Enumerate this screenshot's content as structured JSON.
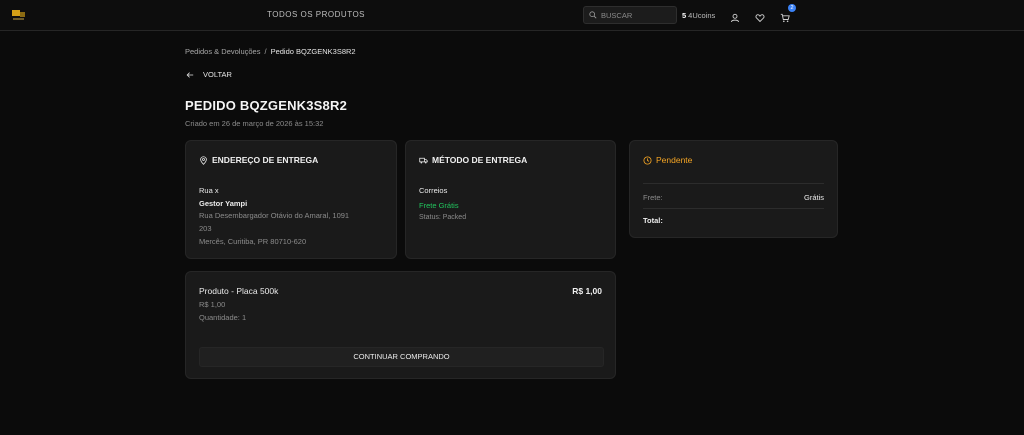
{
  "header": {
    "nav_all_products": "TODOS OS PRODUTOS",
    "search_placeholder": "BUSCAR",
    "coins_value": "5",
    "coins_unit": "4Ucoins",
    "cart_count": "2"
  },
  "breadcrumb": {
    "parent": "Pedidos & Devoluções",
    "separator": "/",
    "current": "Pedido BQZGENK3S8R2"
  },
  "back_label": "VOLTAR",
  "order": {
    "title": "PEDIDO BQZGENK3S8R2",
    "created": "Criado em 26 de março de 2026 às 15:32"
  },
  "address": {
    "heading": "ENDEREÇO DE ENTREGA",
    "line1": "Rua x",
    "name": "Gestor Yampi",
    "street": "Rua Desembargador Otávio do Amaral, 1091",
    "complement": "203",
    "city": "Mercês, Curitiba, PR 80710-620"
  },
  "shipping": {
    "heading": "MÉTODO DE ENTREGA",
    "carrier": "Correios",
    "free_label": "Frete Grátis",
    "status": "Status: Packed"
  },
  "summary": {
    "status": "Pendente",
    "freight_label": "Frete:",
    "freight_value": "Grátis",
    "total_label": "Total:"
  },
  "product": {
    "name": "Produto - Placa 500k",
    "price_right": "R$ 1,00",
    "price": "R$ 1,00",
    "quantity": "Quantidade: 1",
    "continue_label": "CONTINUAR COMPRANDO"
  },
  "colors": {
    "accent_orange": "#f5a524",
    "free_green": "#22c55e",
    "badge_blue": "#3b82f6"
  },
  "icons": {
    "logo": "brand-logo",
    "search": "search-icon",
    "user": "user-icon",
    "heart": "heart-icon",
    "cart": "cart-icon",
    "back": "arrow-left-icon",
    "address": "map-pin-icon",
    "shipping": "truck-icon",
    "status": "clock-icon"
  }
}
